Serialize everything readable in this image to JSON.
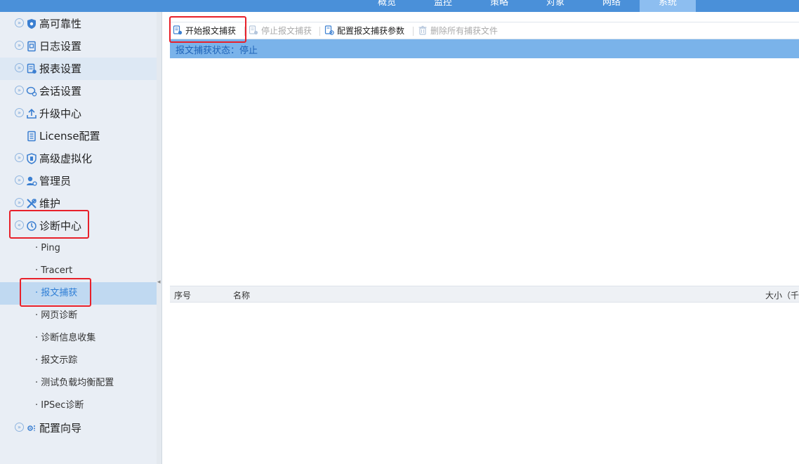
{
  "topnav": {
    "tabs": [
      {
        "label": "概览"
      },
      {
        "label": "监控"
      },
      {
        "label": "策略"
      },
      {
        "label": "对象"
      },
      {
        "label": "网络"
      },
      {
        "label": "系统",
        "active": true
      }
    ]
  },
  "sidebar": {
    "items": [
      {
        "label": "高可靠性",
        "icon": "shield-icon"
      },
      {
        "label": "日志设置",
        "icon": "log-icon"
      },
      {
        "label": "报表设置",
        "icon": "report-icon"
      },
      {
        "label": "会话设置",
        "icon": "session-icon"
      },
      {
        "label": "升级中心",
        "icon": "upload-icon"
      },
      {
        "label": "License配置",
        "icon": "license-icon"
      },
      {
        "label": "高级虚拟化",
        "icon": "virtualization-icon"
      },
      {
        "label": "管理员",
        "icon": "admin-icon"
      },
      {
        "label": "维护",
        "icon": "tools-icon"
      },
      {
        "label": "诊断中心",
        "icon": "diagnosis-icon"
      }
    ],
    "diagnosis_children": [
      {
        "label": "Ping"
      },
      {
        "label": "Tracert"
      },
      {
        "label": "报文捕获",
        "selected": true
      },
      {
        "label": "网页诊断"
      },
      {
        "label": "诊断信息收集"
      },
      {
        "label": "报文示踪"
      },
      {
        "label": "测试负载均衡配置"
      },
      {
        "label": "IPSec诊断"
      }
    ],
    "last_item": {
      "label": "配置向导",
      "icon": "wizard-icon"
    }
  },
  "toolbar": {
    "start_capture": "开始报文捕获",
    "stop_capture": "停止报文捕获",
    "config_params": "配置报文捕获参数",
    "delete_all": "删除所有捕获文件"
  },
  "status": {
    "text": "报文捕获状态：停止"
  },
  "table": {
    "columns": [
      "序号",
      "名称",
      "大小（千"
    ]
  },
  "colors": {
    "nav_bg": "#4a90d9",
    "status_bar": "#7ab3ea",
    "status_text": "#1e63b8",
    "annotation": "#e8202a",
    "selected_text": "#2f7fd6"
  }
}
